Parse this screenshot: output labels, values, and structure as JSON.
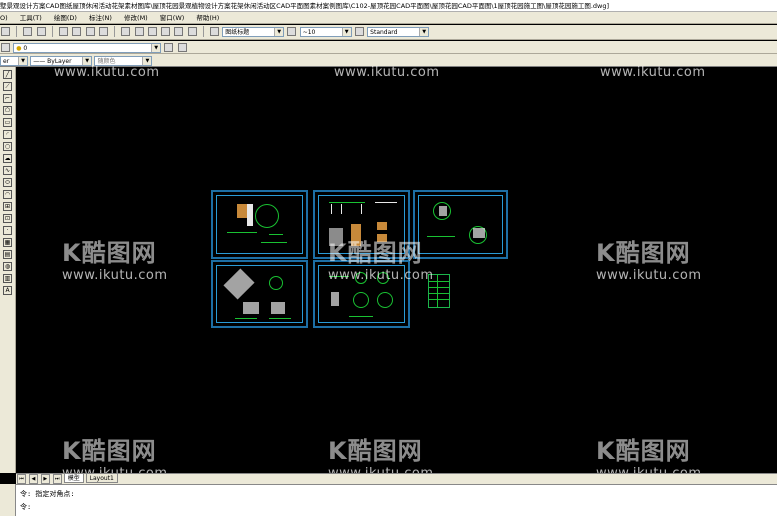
{
  "window": {
    "title": "墅景观设计方案CAD图纸屋顶休闲活动花架素材图库\\屋顶花园景观植物设计方案花架休闲活动区CAD平面图素材案例图库\\C102-屋顶花园CAD平面图\\屋顶花园CAD平面图\\1屋顶花园施工图\\屋顶花园施工图.dwg]"
  },
  "menu": {
    "items": [
      "O)",
      "工具(T)",
      "绘图(D)",
      "标注(N)",
      "修改(M)",
      "窗口(W)",
      "帮助(H)"
    ]
  },
  "toolbar": {
    "text_style": "图纸标题",
    "dim_value": "~10",
    "dim_style": "Standard",
    "layer_value": "0",
    "linetype_left": "er",
    "linetype": "ByLayer",
    "lineweight": "随颜色"
  },
  "watermark": {
    "brand": "酷图网",
    "url": "www.ikutu.com"
  },
  "tabs": {
    "model": "模型",
    "layout": "Layout1"
  },
  "command": {
    "line1": "令:  指定对角点:",
    "line2": "令:"
  },
  "colors": {
    "canvas_bg": "#000000",
    "frame_blue": "#1d6fa5",
    "drawing_green": "#19c132",
    "drawing_orange": "#c7893a"
  }
}
